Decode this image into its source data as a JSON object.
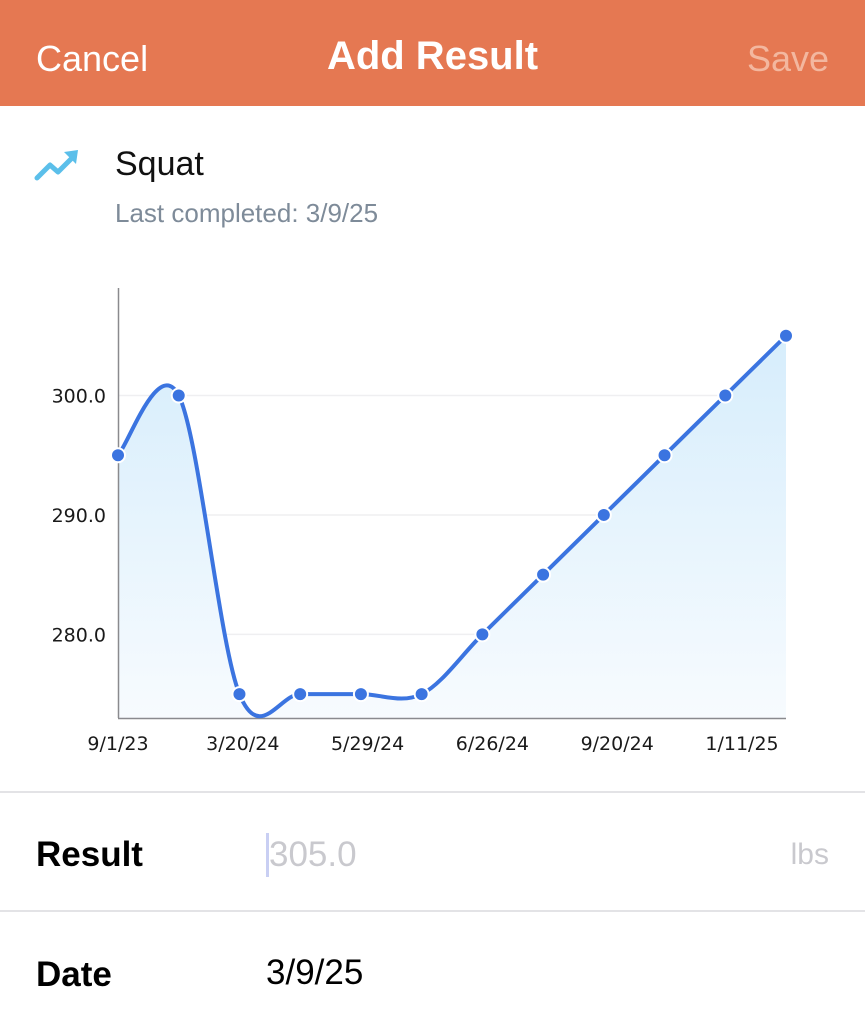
{
  "navbar": {
    "cancel_label": "Cancel",
    "title": "Add Result",
    "save_label": "Save",
    "background_color": "#E57852"
  },
  "exercise": {
    "icon": "trending-up-icon",
    "name": "Squat",
    "last_completed": "Last completed: 3/9/25"
  },
  "chart_data": {
    "type": "line",
    "series": [
      {
        "values": [
          295,
          300,
          275,
          275,
          275,
          275,
          280,
          285,
          290,
          295,
          300,
          305
        ]
      }
    ],
    "yticks": [
      "280.0",
      "290.0",
      "300.0"
    ],
    "ytick_values": [
      280,
      290,
      300
    ],
    "xticks": [
      "9/1/23",
      "3/20/24",
      "5/29/24",
      "6/26/24",
      "9/20/24",
      "1/11/25"
    ],
    "ylim": [
      273,
      309
    ],
    "grid": true,
    "line_color": "#3B74E0",
    "fill_color": "#DCEFFC"
  },
  "result": {
    "label": "Result",
    "placeholder": "305.0",
    "unit": "lbs"
  },
  "date": {
    "label": "Date",
    "value": "3/9/25"
  }
}
